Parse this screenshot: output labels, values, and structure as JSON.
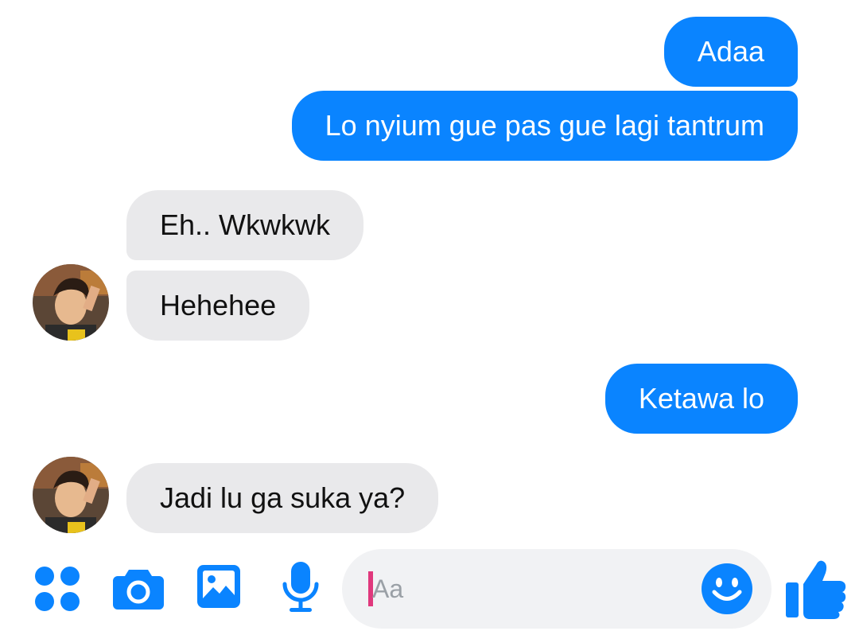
{
  "thread": {
    "messages": [
      {
        "sender": "me",
        "text": "Adaa"
      },
      {
        "sender": "me",
        "text": "Lo nyium gue pas gue lagi tantrum"
      },
      {
        "sender": "other",
        "text": "Eh.. Wkwkwk"
      },
      {
        "sender": "other",
        "text": "Hehehee"
      },
      {
        "sender": "me",
        "text": "Ketawa lo"
      },
      {
        "sender": "other",
        "text": "Jadi lu ga suka ya?"
      }
    ]
  },
  "composer": {
    "placeholder": "Aa",
    "icons": {
      "more": "four-dots-icon",
      "camera": "camera-icon",
      "gallery": "image-icon",
      "voice": "microphone-icon",
      "emoji": "smiley-icon",
      "like": "thumbs-up-icon"
    }
  },
  "colors": {
    "outgoing_bubble": "#0a84ff",
    "incoming_bubble": "#e9e9eb",
    "accent": "#0a84ff",
    "caret": "#e0387c"
  }
}
